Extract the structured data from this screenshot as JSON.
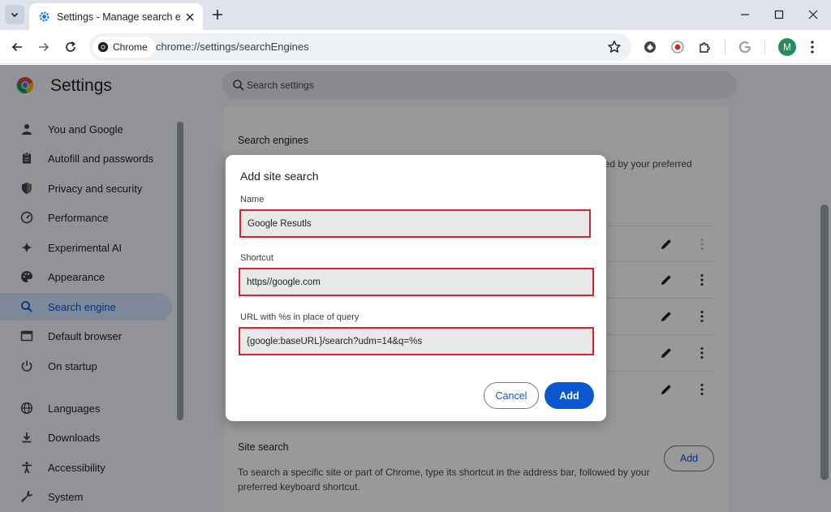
{
  "browser": {
    "tab_title": "Settings - Manage search engin",
    "omnibox_chip": "Chrome",
    "url": "chrome://settings/searchEngines",
    "avatar_initial": "M"
  },
  "settings": {
    "title": "Settings",
    "search_placeholder": "Search settings",
    "nav": [
      {
        "label": "You and Google",
        "icon": "person-icon"
      },
      {
        "label": "Autofill and passwords",
        "icon": "clipboard-icon"
      },
      {
        "label": "Privacy and security",
        "icon": "shield-icon"
      },
      {
        "label": "Performance",
        "icon": "speedometer-icon"
      },
      {
        "label": "Experimental AI",
        "icon": "sparkle-icon"
      },
      {
        "label": "Appearance",
        "icon": "palette-icon"
      },
      {
        "label": "Search engine",
        "icon": "search-icon",
        "active": true
      },
      {
        "label": "Default browser",
        "icon": "browser-icon"
      },
      {
        "label": "On startup",
        "icon": "power-icon"
      },
      {
        "label": "Languages",
        "icon": "globe-icon"
      },
      {
        "label": "Downloads",
        "icon": "download-icon"
      },
      {
        "label": "Accessibility",
        "icon": "accessibility-icon"
      },
      {
        "label": "System",
        "icon": "wrench-icon"
      }
    ],
    "search_engines": {
      "title": "Search engines",
      "description_fragment": "wed by your preferred"
    },
    "site_search": {
      "title": "Site search",
      "description": "To search a specific site or part of Chrome, type its shortcut in the address bar, followed by your preferred keyboard shortcut.",
      "add_label": "Add"
    }
  },
  "dialog": {
    "title": "Add site search",
    "name_label": "Name",
    "name_value": "Google Resutls",
    "shortcut_label": "Shortcut",
    "shortcut_value": "https//google.com",
    "url_label": "URL with %s in place of query",
    "url_value": "{google:baseURL}/search?udm=14&q=%s",
    "cancel_label": "Cancel",
    "add_label": "Add",
    "highlight_color": "#d8232a"
  }
}
